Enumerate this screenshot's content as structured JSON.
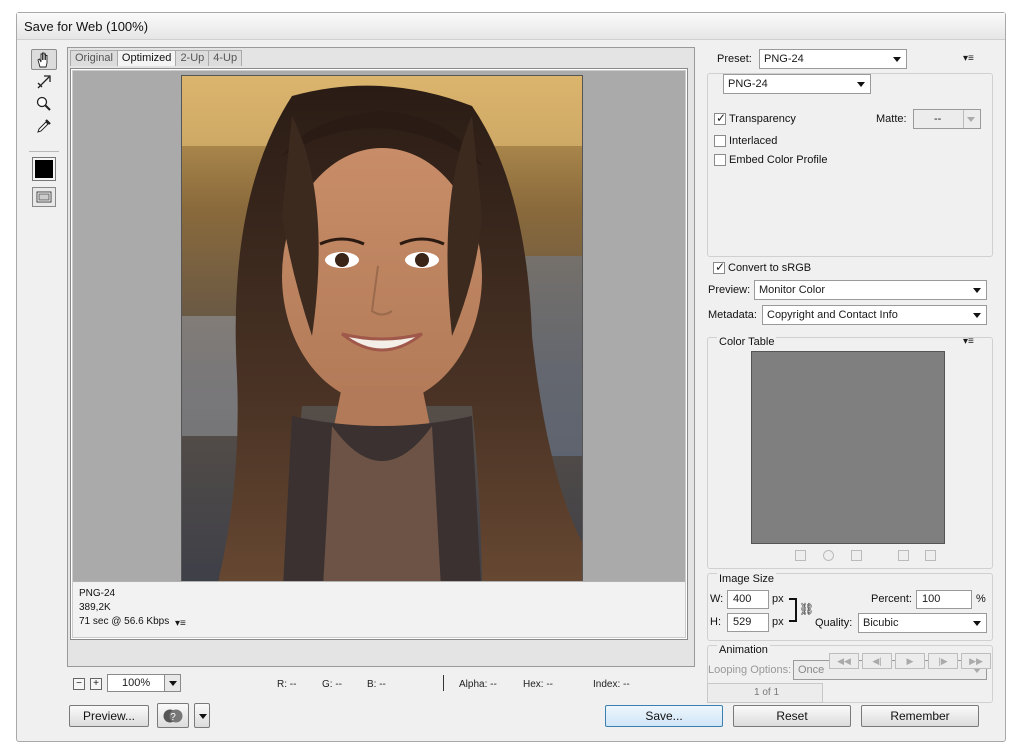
{
  "window": {
    "title": "Save for Web (100%)"
  },
  "tools": [
    {
      "name": "hand-tool-icon"
    },
    {
      "name": "slice-select-tool-icon"
    },
    {
      "name": "zoom-tool-icon"
    },
    {
      "name": "eyedropper-tool-icon"
    }
  ],
  "tabs": [
    {
      "label": "Original"
    },
    {
      "label": "Optimized"
    },
    {
      "label": "2-Up"
    },
    {
      "label": "4-Up"
    }
  ],
  "image_info": {
    "format": "PNG-24",
    "size": "389,2K",
    "download": "71 sec @ 56.6 Kbps"
  },
  "zoom": {
    "minus": "−",
    "plus": "+",
    "value": "100%"
  },
  "readout": {
    "r": "R: --",
    "g": "G: --",
    "b": "B: --",
    "alpha": "Alpha: --",
    "hex": "Hex: --",
    "index": "Index: --"
  },
  "buttons": {
    "preview": "Preview...",
    "save": "Save...",
    "reset": "Reset",
    "remember": "Remember"
  },
  "settings": {
    "preset_label": "Preset:",
    "preset_value": "PNG-24",
    "format_value": "PNG-24",
    "transparency": "Transparency",
    "interlaced": "Interlaced",
    "embed_profile": "Embed Color Profile",
    "matte_label": "Matte:",
    "matte_value": "--",
    "convert_srgb": "Convert to sRGB",
    "preview_label": "Preview:",
    "preview_value": "Monitor Color",
    "metadata_label": "Metadata:",
    "metadata_value": "Copyright and Contact Info"
  },
  "color_table": {
    "title": "Color Table"
  },
  "image_size": {
    "title": "Image Size",
    "w_label": "W:",
    "w_value": "400",
    "h_label": "H:",
    "h_value": "529",
    "unit": "px",
    "percent_label": "Percent:",
    "percent_value": "100",
    "percent_unit": "%",
    "quality_label": "Quality:",
    "quality_value": "Bicubic"
  },
  "animation": {
    "title": "Animation",
    "looping_label": "Looping Options:",
    "looping_value": "Once",
    "frame_counter": "1 of 1"
  },
  "colors": {
    "window_bg": "#f0f0f0",
    "canvas_bg": "#aaaaaa",
    "color_table_bg": "#7f7f7f",
    "save_button": "#cfe6f7"
  }
}
